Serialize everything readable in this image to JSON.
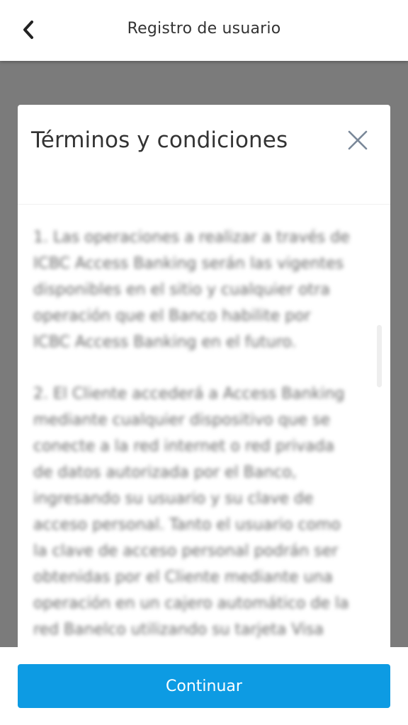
{
  "header": {
    "title": "Registro de usuario",
    "back_icon": "chevron-left-icon"
  },
  "modal": {
    "title": "Términos y condiciones",
    "close_icon": "close-icon",
    "paragraphs": [
      "1. Las operaciones a realizar a través de ICBC Access Banking serán las vigentes disponibles en el sitio y cualquier otra operación que el Banco habilite por ICBC Access Banking en el futuro.",
      "2. El Cliente accederá a Access Banking mediante cualquier dispositivo que se conecte a la red internet o red privada de datos autorizada por el Banco, ingresando su usuario y su clave de acceso personal. Tanto el usuario como la clave de acceso personal podrán ser obtenidas por el Cliente mediante una operación en un cajero automático de la red Banelco utilizando su tarjeta Visa"
    ]
  },
  "footer": {
    "continue_label": "Continuar"
  },
  "colors": {
    "accent": "#0d9be3",
    "overlay": "#7b7b7b",
    "text": "#333333"
  }
}
